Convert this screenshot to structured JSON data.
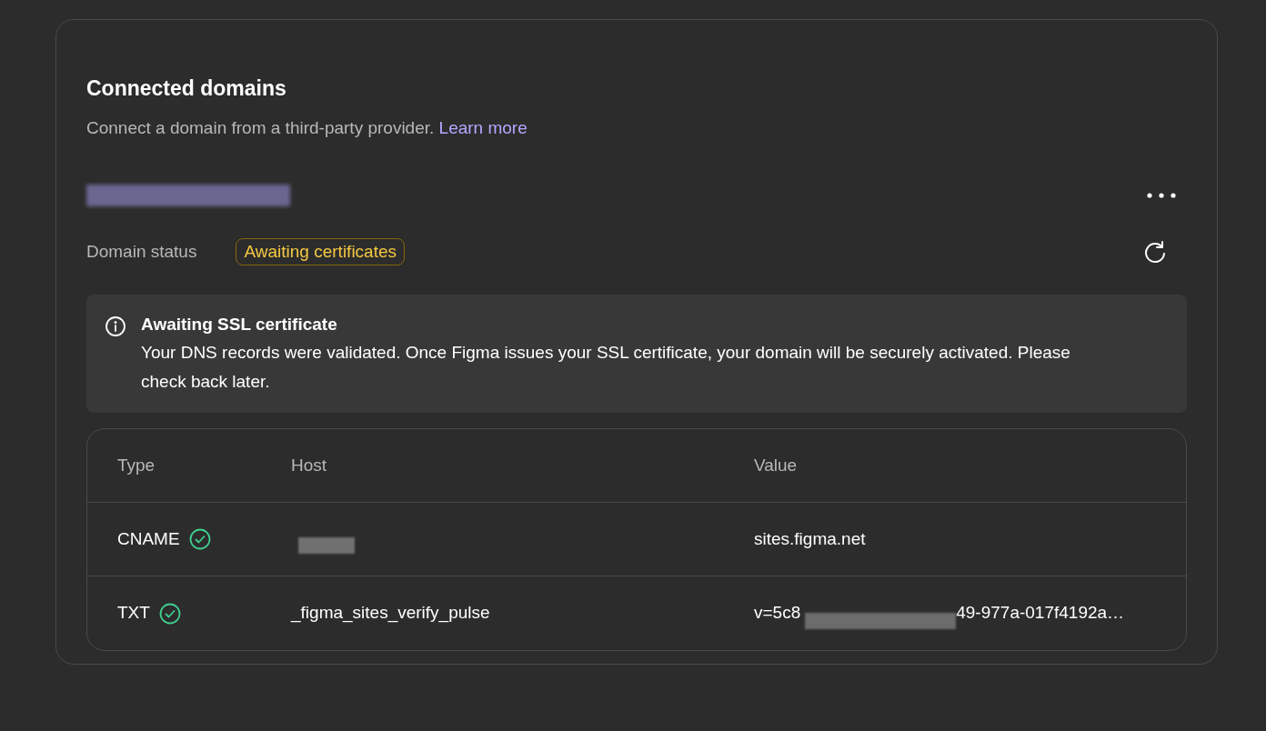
{
  "card": {
    "title": "Connected domains",
    "description": "Connect a domain from a third-party provider.",
    "link": "Learn more"
  },
  "domain": {
    "status_label": "Domain status",
    "status": "Awaiting certificates"
  },
  "notice": {
    "title": "Awaiting SSL certificate",
    "body": "Your DNS records were validated. Once Figma issues your SSL certificate, your domain will be securely activated. Please check back later."
  },
  "table": {
    "columns": [
      "Type",
      "Host",
      "Value"
    ],
    "rows": [
      {
        "type": "CNAME",
        "verified": true,
        "host": null,
        "host_redacted": true,
        "value": "sites.figma.net",
        "value_redacted": false,
        "value_end": null
      },
      {
        "type": "TXT",
        "verified": true,
        "host": "_figma_sites_verify_pulse",
        "host_redacted": false,
        "value": "v=5c8",
        "value_redacted": true,
        "value_end": "49-977a-017f4192a…"
      }
    ]
  }
}
